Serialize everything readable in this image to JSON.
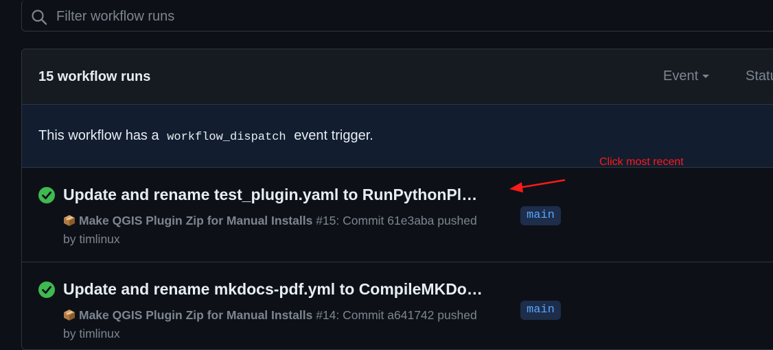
{
  "filter": {
    "placeholder": "Filter workflow runs"
  },
  "header": {
    "runs_count": "15 workflow runs",
    "event_label": "Event",
    "status_label": "Statu"
  },
  "banner": {
    "prefix": "This workflow has a",
    "code": "workflow_dispatch",
    "suffix": "event trigger."
  },
  "annotation": {
    "text": "Click most recent",
    "color": "#ff1a1a"
  },
  "runs": [
    {
      "title": "Update and rename test_plugin.yaml to RunPythonPl…",
      "workflow": "Make QGIS Plugin Zip for Manual Installs",
      "number": "#15",
      "detail": ": Commit 61e3aba pushed",
      "author": "by timlinux",
      "branch": "main",
      "status": "success"
    },
    {
      "title": "Update and rename mkdocs-pdf.yml to CompileMKDo…",
      "workflow": "Make QGIS Plugin Zip for Manual Installs",
      "number": "#14",
      "detail": ": Commit a641742 pushed",
      "author": "by timlinux",
      "branch": "main",
      "status": "success"
    }
  ],
  "colors": {
    "background": "#0d1117",
    "success": "#3fb950",
    "link": "#58a6ff"
  }
}
